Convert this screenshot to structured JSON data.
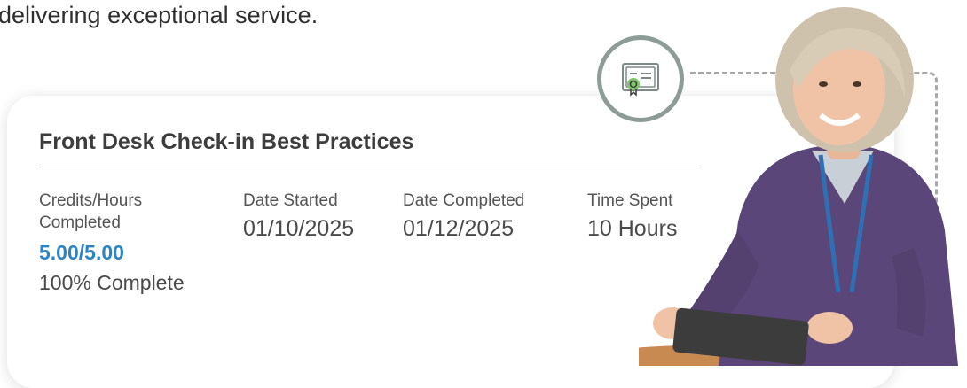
{
  "intro": {
    "text": "delivering exceptional service."
  },
  "course": {
    "title": "Front Desk Check-in Best Practices",
    "credits_label": "Credits/Hours Completed",
    "credits_value": "5.00/5.00",
    "percent_complete": "100% Complete",
    "date_started_label": "Date Started",
    "date_started_value": "01/10/2025",
    "date_completed_label": "Date Completed",
    "date_completed_value": "01/12/2025",
    "time_spent_label": "Time Spent",
    "time_spent_value": "10 Hours"
  },
  "icons": {
    "certificate": "certificate-icon"
  },
  "colors": {
    "accent": "#2b84c4",
    "badge_ring": "#8e9c98",
    "badge_seal": "#7fc46a"
  }
}
